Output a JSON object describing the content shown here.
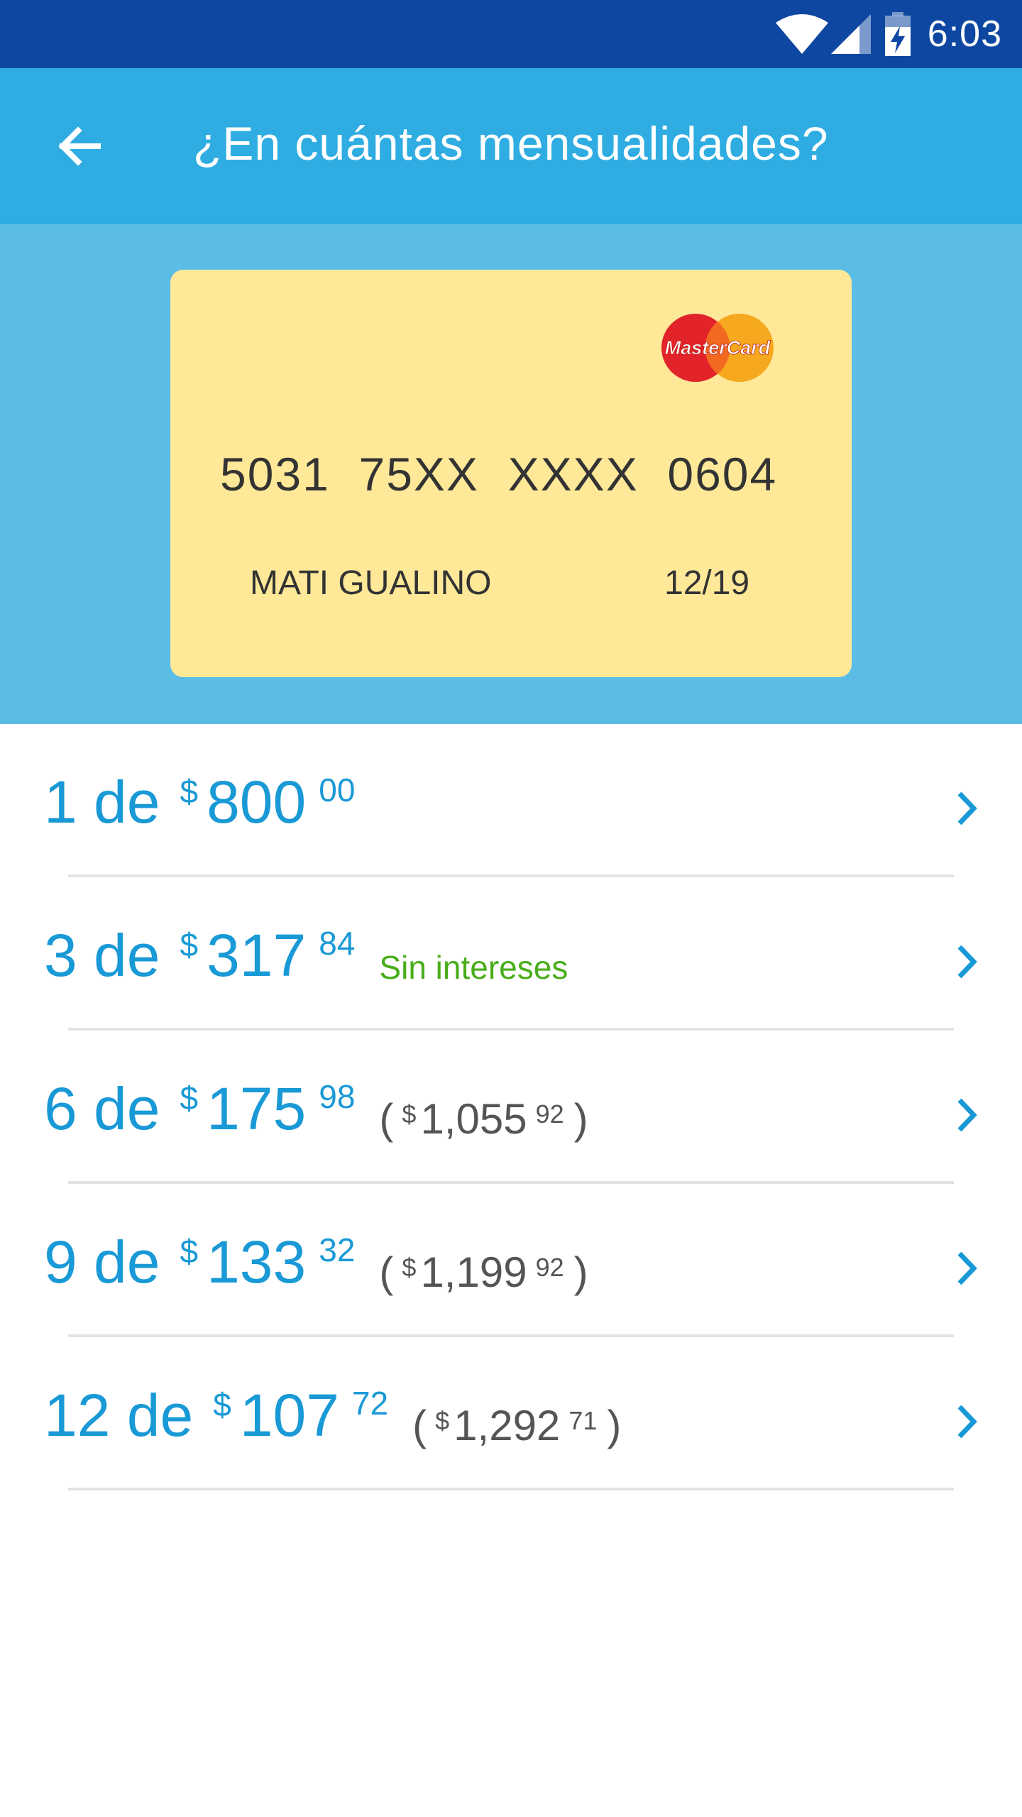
{
  "status_bar": {
    "time": "6:03"
  },
  "app_bar": {
    "title": "¿En cuántas mensualidades?"
  },
  "card": {
    "brand": "MasterCard",
    "number": "5031  75XX  XXXX  0604",
    "holder": "MATI GUALINO",
    "expiry": "12/19"
  },
  "installments": [
    {
      "qty": "1 de",
      "currency": "$",
      "amount": "800",
      "cents": "00"
    },
    {
      "qty": "3 de",
      "currency": "$",
      "amount": "317",
      "cents": "84",
      "note": "Sin intereses"
    },
    {
      "qty": "6 de",
      "currency": "$",
      "amount": "175",
      "cents": "98",
      "total": {
        "open": "(",
        "currency": "$",
        "amount": "1,055",
        "cents": "92",
        "close": ")"
      }
    },
    {
      "qty": "9 de",
      "currency": "$",
      "amount": "133",
      "cents": "32",
      "total": {
        "open": "(",
        "currency": "$",
        "amount": "1,199",
        "cents": "92",
        "close": ")"
      }
    },
    {
      "qty": "12 de",
      "currency": "$",
      "amount": "107",
      "cents": "72",
      "total": {
        "open": "(",
        "currency": "$",
        "amount": "1,292",
        "cents": "71",
        "close": ")"
      }
    }
  ],
  "colors": {
    "status_bar": "#0e47a1",
    "app_bar": "#2fade2",
    "card_area": "#5bbde6",
    "card": "#ffe999",
    "accent": "#1999d6",
    "no_interest": "#49ad1a"
  }
}
